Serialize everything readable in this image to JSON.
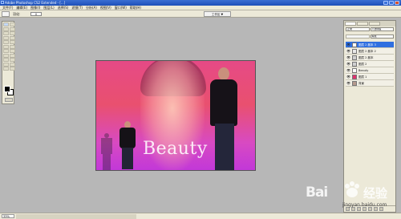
{
  "app": {
    "title": "Adobe Photoshop CS2 Extended - [...]",
    "window_controls": [
      "minimize",
      "maximize",
      "close"
    ]
  },
  "menu": {
    "items": [
      "文件(F)",
      "编辑(E)",
      "图像(I)",
      "图层(L)",
      "选择(S)",
      "滤镜(T)",
      "分析(A)",
      "视图(V)",
      "窗口(W)",
      "帮助(H)"
    ]
  },
  "options": {
    "label": "羽化:",
    "value": "0",
    "workspace_button": "工作区 ▼"
  },
  "document": {
    "text_layer_content": "Beauty"
  },
  "layers_panel": {
    "blend_mode": "正常",
    "opacity_label": "不透明度",
    "fill_label": "填充",
    "layers": [
      {
        "name": "图层 2 副本 3",
        "selected": true,
        "thumb_color": "#ffffff"
      },
      {
        "name": "图层 2 副本 2",
        "selected": false,
        "thumb_color": "#e9e9e9"
      },
      {
        "name": "图层 2 副本",
        "selected": false,
        "thumb_color": "#cfcfcf"
      },
      {
        "name": "图层 2",
        "selected": false,
        "thumb_color": "#d0d0d0"
      },
      {
        "name": "Beauty",
        "selected": false,
        "thumb_color": "#ffffff",
        "is_text": true
      },
      {
        "name": "图层 1",
        "selected": false,
        "thumb_color": "#e0336e"
      },
      {
        "name": "背景",
        "selected": false,
        "thumb_color": "#b59a8e"
      }
    ]
  },
  "status": {
    "zoom": "33%"
  },
  "watermark": {
    "brand": "Bai",
    "suffix": "经验",
    "url": "jingyan.baidu.com"
  }
}
